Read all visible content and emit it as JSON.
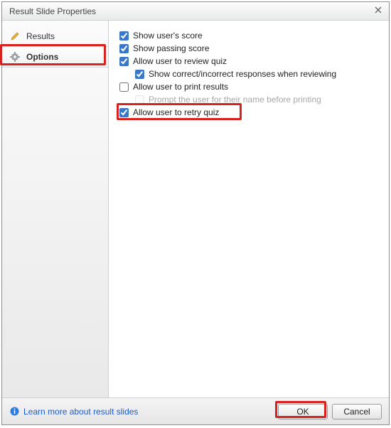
{
  "window": {
    "title": "Result Slide Properties"
  },
  "sidebar": {
    "items": [
      {
        "label": "Results",
        "icon": "pencil-icon",
        "selected": false
      },
      {
        "label": "Options",
        "icon": "gear-icon",
        "selected": true
      }
    ]
  },
  "options": {
    "show_user_score": {
      "label": "Show user's score",
      "checked": true
    },
    "show_passing_score": {
      "label": "Show passing score",
      "checked": true
    },
    "allow_review": {
      "label": "Allow user to review quiz",
      "checked": true
    },
    "show_correct_incorrect": {
      "label": "Show correct/incorrect responses when reviewing",
      "checked": true
    },
    "allow_print": {
      "label": "Allow user to print results",
      "checked": false
    },
    "prompt_name": {
      "label": "Prompt the user for their name before printing",
      "checked": false,
      "disabled": true
    },
    "allow_retry": {
      "label": "Allow user to retry quiz",
      "checked": true
    }
  },
  "footer": {
    "learn_more": "Learn more about result slides",
    "ok": "OK",
    "cancel": "Cancel"
  },
  "highlights": {
    "color": "#d62320"
  }
}
